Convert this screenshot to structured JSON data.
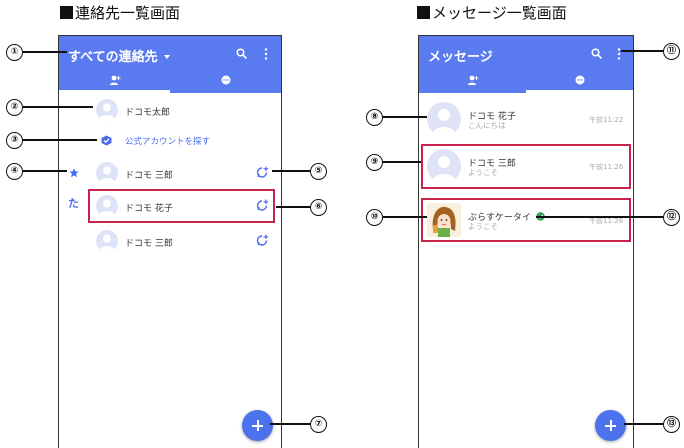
{
  "left_title": "連絡先一覧画面",
  "right_title": "メッセージ一覧画面",
  "contacts_screen": {
    "appbar_title": "すべての連絡先",
    "menu_icon": "more-vert-icon",
    "search_icon": "search-icon",
    "tab_contacts_icon": "person-add-icon",
    "tab_messages_icon": "chat-icon",
    "rows": [
      {
        "name": "ドコモ太郎"
      },
      {
        "link": "公式アカウントを探す"
      },
      {
        "name": "ドコモ 三郎",
        "badge": "favorite-star-icon"
      },
      {
        "index": "た",
        "name": "ドコモ 花子"
      },
      {
        "name": "ドコモ 三郎"
      }
    ]
  },
  "messages_screen": {
    "appbar_title": "メッセージ",
    "rows": [
      {
        "name": "ドコモ 花子",
        "preview": "こんにちは",
        "time": "午前11:22"
      },
      {
        "name": "ドコモ 三郎",
        "preview": "ようこそ",
        "time": "午前11:26"
      },
      {
        "name": "ぷらすケータイ",
        "preview": "ようこそ",
        "time": "午前11:26",
        "verified": true
      }
    ]
  },
  "callouts": [
    "①",
    "②",
    "③",
    "④",
    "⑤",
    "⑥",
    "⑦",
    "⑧",
    "⑨",
    "⑩",
    "⑪",
    "⑫",
    "⑬"
  ],
  "colors": {
    "accent": "#5a7bef",
    "highlight": "#c8234a",
    "link": "#4a6cf0"
  }
}
